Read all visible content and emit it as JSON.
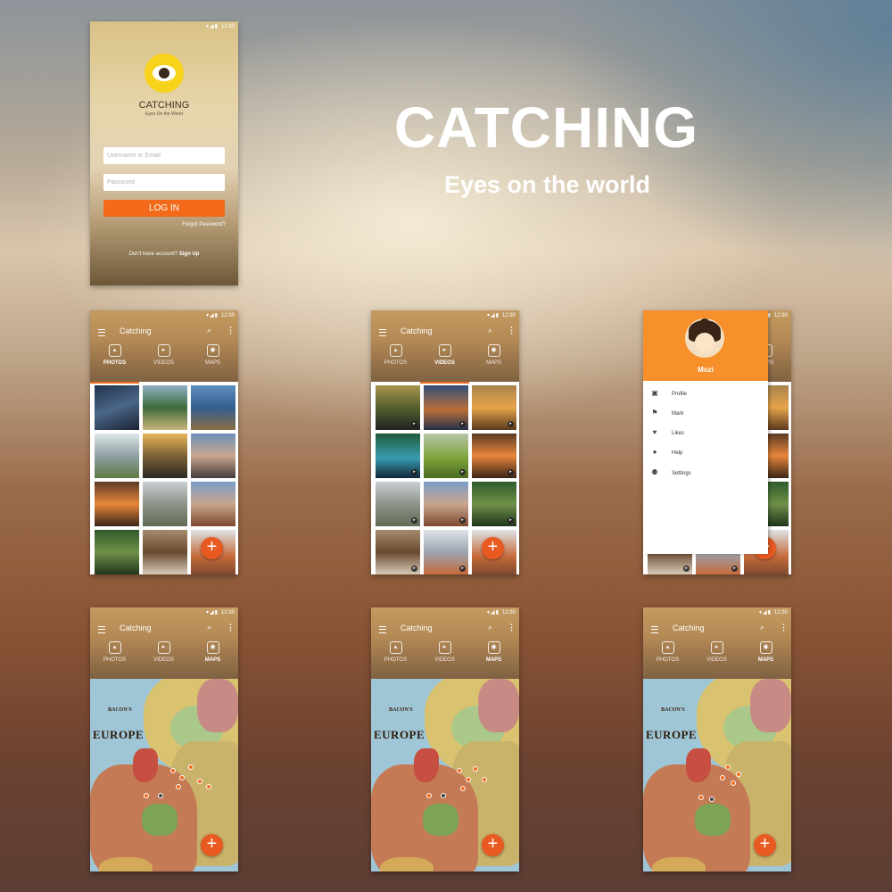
{
  "hero": {
    "title": "CATCHING",
    "subtitle": "Eyes on the world"
  },
  "status": {
    "time": "12:30"
  },
  "login": {
    "app_name": "CATCHING",
    "tagline": "Eyes On the World",
    "username_placeholder": "Username or Email",
    "password_placeholder": "Password",
    "login_button": "LOG IN",
    "forgot_password": "Forgot Password?",
    "signup_prompt": "Don't have account?",
    "signup_link": "Sign Up"
  },
  "app": {
    "title": "Catching",
    "tabs": {
      "photos": "PHOTOS",
      "videos": "VIDEOS",
      "maps": "MAPS"
    },
    "fab_symbol": "+"
  },
  "drawer": {
    "user_name": "Mozi",
    "items": [
      {
        "label": "Profile",
        "icon": "profile-icon"
      },
      {
        "label": "Mark",
        "icon": "flag-icon"
      },
      {
        "label": "Likes",
        "icon": "heart-icon"
      },
      {
        "label": "Help",
        "icon": "info-icon"
      },
      {
        "label": "Settings",
        "icon": "people-icon"
      }
    ]
  },
  "map": {
    "publisher": "BACON'S",
    "title": "EUROPE"
  },
  "colors": {
    "accent": "#f26a1a",
    "drawer_header": "#f7902b",
    "fab": "#e95a22"
  }
}
